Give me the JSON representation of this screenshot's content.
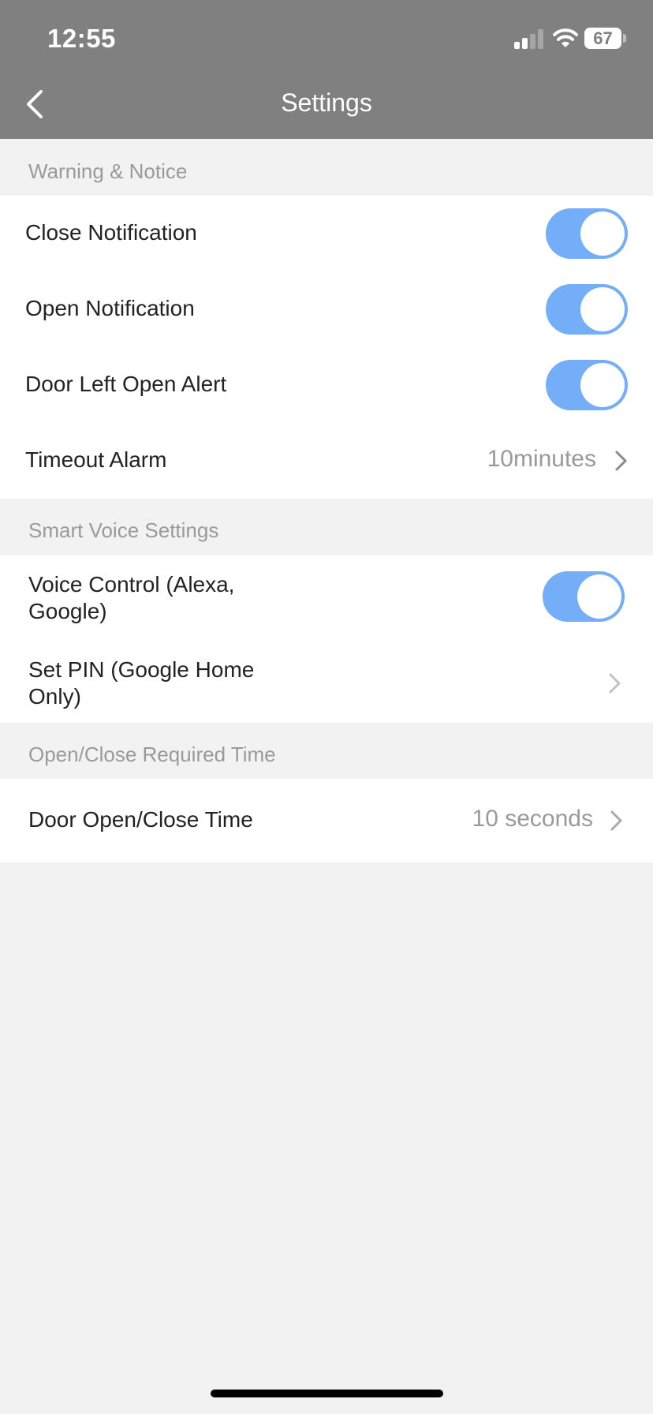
{
  "status_bar": {
    "time": "12:55",
    "battery_level": "67",
    "signal_icon": "cellular-signal-icon",
    "wifi_icon": "wifi-icon"
  },
  "header": {
    "title": "Settings",
    "back_icon": "chevron-left-icon"
  },
  "sections": {
    "warning": {
      "title": "Warning & Notice",
      "close_notification": {
        "label": "Close Notification",
        "enabled": true
      },
      "open_notification": {
        "label": "Open Notification",
        "enabled": true
      },
      "door_left_open_alert": {
        "label": "Door Left Open Alert",
        "enabled": true
      },
      "timeout_alarm": {
        "label": "Timeout Alarm",
        "value": "10minutes"
      }
    },
    "voice": {
      "title": "Smart Voice Settings",
      "voice_control": {
        "label_line1": "Voice Control (Alexa,",
        "label_line2": "Google)",
        "enabled": true
      },
      "set_pin": {
        "label_line1": "Set PIN (Google Home",
        "label_line2": "Only)"
      }
    },
    "time": {
      "title": "Open/Close Required Time",
      "door_time": {
        "label": "Door Open/Close Time",
        "value": "10 seconds"
      }
    }
  },
  "colors": {
    "header_bg": "#808080",
    "page_bg": "#f2f2f2",
    "toggle_on": "#74aef8",
    "secondary_text": "#9a9a9a"
  }
}
